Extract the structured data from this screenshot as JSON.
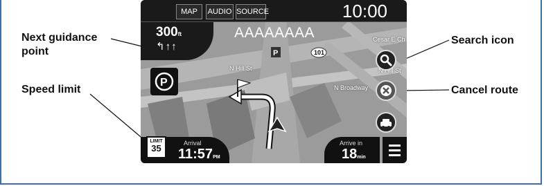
{
  "labels": {
    "next_guidance": "Next guidance point",
    "next_guidance_line1": "Next guidance",
    "next_guidance_line2": "point",
    "speed_limit": "Speed limit",
    "search_icon": "Search icon",
    "cancel_route": "Cancel route"
  },
  "nav": {
    "tabs": [
      "MAP",
      "AUDIO",
      "SOURCE"
    ],
    "clock": "10:00",
    "distance": "300",
    "distance_unit": "ft",
    "lane_arrows": "↰↑↑",
    "street_name": "AAAAAAAA",
    "map_labels": [
      "N Hill St",
      "N Hill St",
      "N Broadway",
      "Cesar E Ch",
      "101"
    ],
    "speed_limit_label": "LIMIT",
    "speed_limit_value": "35",
    "arrival_label": "Arrival",
    "arrival_time": "11:57",
    "arrival_ampm": "PM",
    "arrive_in_label": "Arrive in",
    "arrive_in_value": "18",
    "arrive_in_unit": "min"
  },
  "colors": {
    "frame": "#3a6fb0",
    "bar": "#1a1a1a",
    "map": "#9a9a9a"
  }
}
